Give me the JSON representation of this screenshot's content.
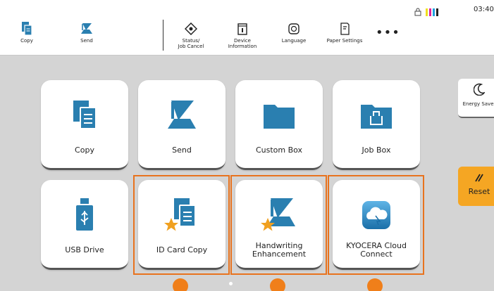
{
  "topbar": {
    "copy_label": "Copy",
    "send_label": "Send",
    "status_label": "Status/\nJob Cancel",
    "device_label": "Device\nInformation",
    "language_label": "Language",
    "paper_label": "Paper Settings",
    "more_label": "•••",
    "clock": "03:40"
  },
  "tiles": [
    {
      "label": "Copy"
    },
    {
      "label": "Send"
    },
    {
      "label": "Custom Box"
    },
    {
      "label": "Job Box"
    },
    {
      "label": "USB Drive"
    },
    {
      "label": "ID Card Copy"
    },
    {
      "label": "Handwriting\nEnhancement"
    },
    {
      "label": "KYOCERA Cloud\nConnect"
    }
  ],
  "side": {
    "energy_label": "Energy Saver",
    "reset_label": "Reset"
  },
  "colors": {
    "accent": "#f07f1a",
    "icon_blue": "#2a7fb0",
    "reset_bg": "#f5a623"
  }
}
